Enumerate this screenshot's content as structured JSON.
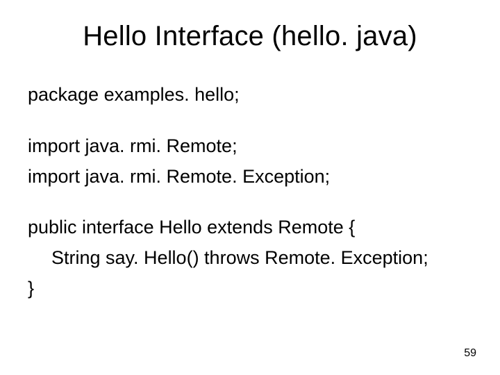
{
  "slide": {
    "title": "Hello Interface (hello. java)",
    "lines": {
      "package": "package examples. hello;",
      "import1": "import java. rmi. Remote;",
      "import2": "import java. rmi. Remote. Exception;",
      "iface_open": "public interface Hello extends Remote {",
      "method": "String say. Hello() throws Remote. Exception;",
      "close": "}"
    },
    "page_number": "59"
  }
}
